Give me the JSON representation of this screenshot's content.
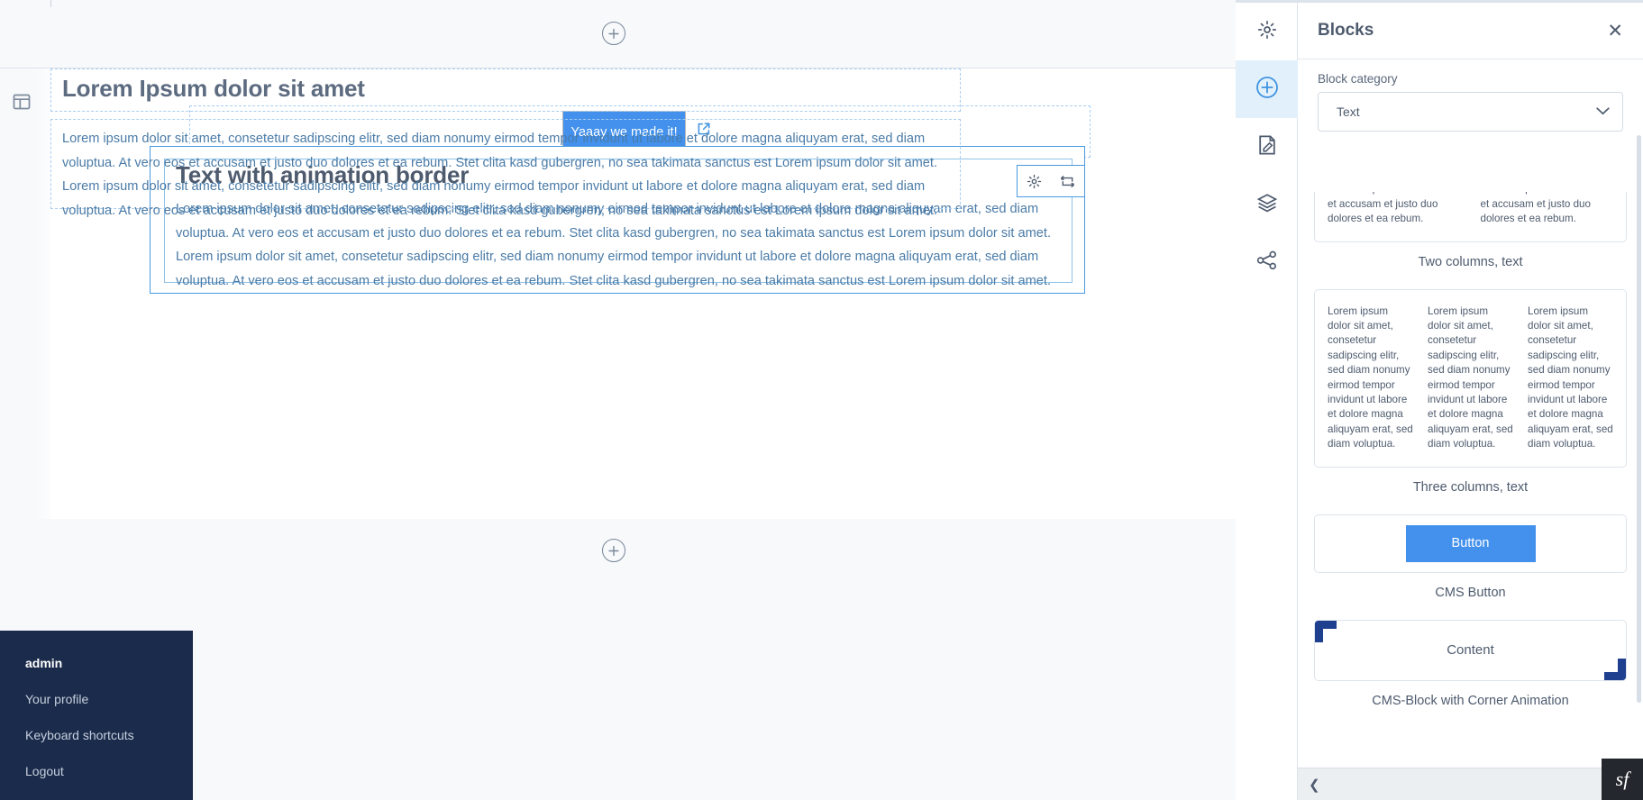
{
  "canvas": {
    "add_block_top": "add-block-top",
    "add_block_bottom": "add-block-bottom",
    "button_block": {
      "label": "Yaaay we made it!",
      "link_icon": "external-link-icon",
      "color": "#4391ec"
    },
    "selected_block": {
      "heading": "Text with animation border",
      "body": "Lorem ipsum dolor sit amet, consetetur sadipscing elitr, sed diam nonumy eirmod tempor invidunt ut labore et dolore magna aliquyam erat, sed diam voluptua. At vero eos et accusam et justo duo dolores et ea rebum. Stet clita kasd gubergren, no sea takimata sanctus est Lorem ipsum dolor sit amet. Lorem ipsum dolor sit amet, consetetur sadipscing elitr, sed diam nonumy eirmod tempor invidunt ut labore et dolore magna aliquyam erat, sed diam voluptua. At vero eos et accusam et justo duo dolores et ea rebum. Stet clita kasd gubergren, no sea takimata sanctus est Lorem ipsum dolor sit amet.",
      "toolbar": {
        "settings_icon": "gear-icon",
        "swap_icon": "cycle-icon"
      },
      "border_color": "#4a9ae0"
    },
    "second_block": {
      "heading": "Lorem Ipsum dolor sit amet",
      "body": "Lorem ipsum dolor sit amet, consetetur sadipscing elitr, sed diam nonumy eirmod tempor invidunt ut labore et dolore magna aliquyam erat, sed diam voluptua. At vero eos et accusam et justo duo dolores et ea rebum. Stet clita kasd gubergren, no sea takimata sanctus est Lorem ipsum dolor sit amet. Lorem ipsum dolor sit amet, consetetur sadipscing elitr, sed diam nonumy eirmod tempor invidunt ut labore et dolore magna aliquyam erat, sed diam voluptua. At vero eos et accusam et justo duo dolores et ea rebum. Stet clita kasd gubergren, no sea takimata sanctus est Lorem ipsum dolor sit amet."
    },
    "layout_toggle_icon": "layout-panel-icon"
  },
  "user_menu": {
    "username": "admin",
    "items": [
      {
        "label": "Your profile"
      },
      {
        "label": "Keyboard shortcuts"
      },
      {
        "label": "Logout"
      }
    ],
    "background": "#1b2b4b"
  },
  "icon_rail": {
    "items": [
      {
        "icon": "gear-icon",
        "active": false
      },
      {
        "icon": "plus-circle-icon",
        "active": true
      },
      {
        "icon": "edit-document-icon",
        "active": false
      },
      {
        "icon": "layers-icon",
        "active": false
      },
      {
        "icon": "share-nodes-icon",
        "active": false
      }
    ],
    "active_background": "#e2f0fb"
  },
  "panel": {
    "title": "Blocks",
    "close_icon": "close-icon",
    "category_label": "Block category",
    "category_value": "Text",
    "category_chevron": "chevron-down-icon",
    "blocks": [
      {
        "caption": "Two columns, text",
        "type": "columns",
        "columns": [
          "magna aliquyam erat, sed diam voluptua. At vero eos et accusam et justo duo dolores et ea rebum.",
          "magna aliquyam erat, sed diam voluptua. At vero eos et accusam et justo duo dolores et ea rebum."
        ]
      },
      {
        "caption": "Three columns, text",
        "type": "columns",
        "columns": [
          "Lorem ipsum dolor sit amet, consetetur sadipscing elitr, sed diam nonumy eirmod tempor invidunt ut labore et dolore magna aliquyam erat, sed diam voluptua.",
          "Lorem ipsum dolor sit amet, consetetur sadipscing elitr, sed diam nonumy eirmod tempor invidunt ut labore et dolore magna aliquyam erat, sed diam voluptua.",
          "Lorem ipsum dolor sit amet, consetetur sadipscing elitr, sed diam nonumy eirmod tempor invidunt ut labore et dolore magna aliquyam erat, sed diam voluptua."
        ]
      },
      {
        "caption": "CMS Button",
        "type": "button",
        "button_label": "Button",
        "button_color": "#4391ec"
      },
      {
        "caption": "CMS-Block with Corner Animation",
        "type": "content",
        "content_label": "Content",
        "corner_color": "#1f3f8f"
      }
    ]
  },
  "dev_toolbar": {
    "collapse_icon": "chevron-left-icon",
    "logo_label": "sf"
  }
}
